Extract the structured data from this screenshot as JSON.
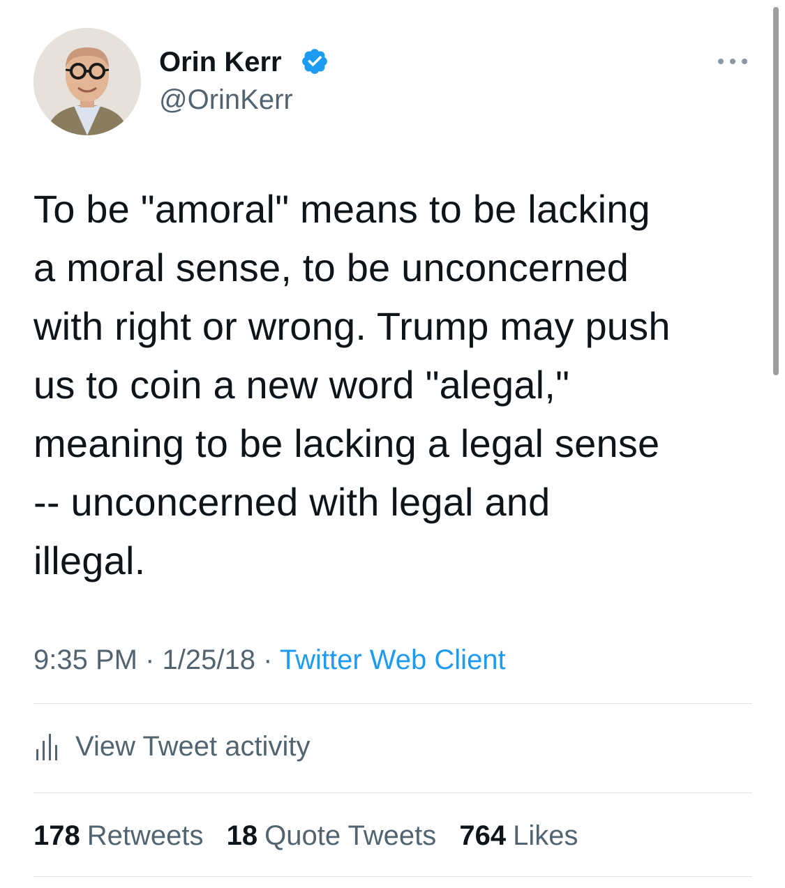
{
  "author": {
    "name": "Orin Kerr",
    "handle": "@OrinKerr",
    "verified": true
  },
  "tweet": {
    "text": "To be \"amoral\" means to be lacking\na moral sense, to be unconcerned\nwith right or wrong. Trump may push\nus to coin a new word \"alegal,\"\nmeaning to be lacking a legal sense\n-- unconcerned with legal and\nillegal.",
    "time": "9:35 PM",
    "separator": "·",
    "date": "1/25/18",
    "source": "Twitter Web Client"
  },
  "activity": {
    "label": "View Tweet activity",
    "icon": "bar-chart-icon"
  },
  "stats": {
    "retweets_count": "178",
    "retweets_label": "Retweets",
    "quotes_count": "18",
    "quotes_label": "Quote Tweets",
    "likes_count": "764",
    "likes_label": "Likes"
  },
  "colors": {
    "text_primary": "#0f1419",
    "text_secondary": "#536471",
    "accent": "#1d9bf0",
    "divider": "#dfe3e6"
  },
  "icons": {
    "more": "more-horizontal-icon",
    "verified": "verified-badge-icon"
  }
}
